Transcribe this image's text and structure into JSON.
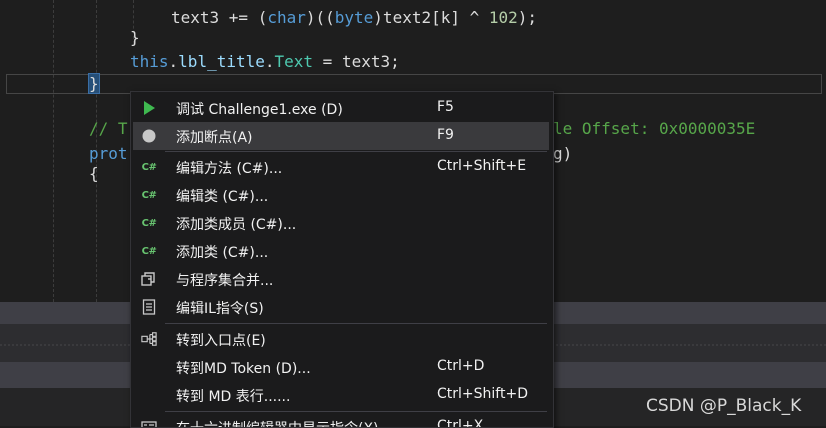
{
  "editor": {
    "lines": [
      {
        "seg": [
          {
            "t": "text3 += (",
            "c": ""
          },
          {
            "t": "char",
            "c": "kw"
          },
          {
            "t": ")((",
            "c": ""
          },
          {
            "t": "byte",
            "c": "kw"
          },
          {
            "t": ")text2[k] ^ ",
            "c": ""
          },
          {
            "t": "102",
            "c": "num"
          },
          {
            "t": ");",
            "c": ""
          }
        ]
      },
      {
        "seg": [
          {
            "t": "}",
            "c": ""
          }
        ]
      },
      {
        "seg": [
          {
            "t": "this",
            "c": "kw"
          },
          {
            "t": ".",
            "c": ""
          },
          {
            "t": "lbl_title",
            "c": "id"
          },
          {
            "t": ".",
            "c": ""
          },
          {
            "t": "Text",
            "c": "ty"
          },
          {
            "t": " = text3;",
            "c": ""
          }
        ]
      },
      {
        "seg": [
          {
            "t": "}",
            "c": "hl"
          }
        ]
      },
      {
        "seg": [
          {
            "t": "",
            "c": ""
          }
        ]
      },
      {
        "seg": [
          {
            "t": "// T",
            "c": "cmt"
          }
        ]
      },
      {
        "seg": [
          {
            "t": "prot",
            "c": "kw"
          }
        ]
      },
      {
        "seg": [
          {
            "t": "{",
            "c": ""
          }
        ]
      }
    ],
    "comment_tail": "le Offset: 0x0000035E",
    "code_tail": "g)"
  },
  "context_menu": {
    "items": [
      {
        "icon": "play-icon",
        "label": "调试 Challenge1.exe (D)",
        "shortcut": "F5",
        "highlighted": false
      },
      {
        "icon": "breakpoint-icon",
        "label": "添加断点(A)",
        "shortcut": "F9",
        "highlighted": true
      },
      {
        "icon": "csharp-icon",
        "label": "编辑方法 (C#)...",
        "shortcut": "Ctrl+Shift+E",
        "highlighted": false
      },
      {
        "icon": "csharp-icon",
        "label": "编辑类 (C#)...",
        "shortcut": "",
        "highlighted": false
      },
      {
        "icon": "csharp-icon",
        "label": "添加类成员 (C#)...",
        "shortcut": "",
        "highlighted": false
      },
      {
        "icon": "csharp-icon",
        "label": "添加类 (C#)...",
        "shortcut": "",
        "highlighted": false
      },
      {
        "icon": "merge-icon",
        "label": "与程序集合并...",
        "shortcut": "",
        "highlighted": false
      },
      {
        "icon": "il-document-icon",
        "label": "编辑IL指令(S)",
        "shortcut": "",
        "highlighted": false
      },
      {
        "icon": "entry-point-icon",
        "label": "转到入口点(E)",
        "shortcut": "",
        "highlighted": false
      },
      {
        "icon": "",
        "label": "转到MD Token (D)...",
        "shortcut": "Ctrl+D",
        "highlighted": false
      },
      {
        "icon": "",
        "label": "转到 MD 表行......",
        "shortcut": "Ctrl+Shift+D",
        "highlighted": false
      },
      {
        "icon": "hex-editor-icon",
        "label": "在十六进制编辑器中显示指令(X)",
        "shortcut": "Ctrl+X",
        "highlighted": false
      }
    ]
  },
  "watermark": "CSDN @P_Black_K",
  "colors": {
    "keyword": "#569cd6",
    "type": "#4ec9b0",
    "comment": "#57a64a",
    "number": "#b5cea8",
    "menu_bg": "#1b1b1c",
    "menu_highlight": "#3a3a3d"
  }
}
